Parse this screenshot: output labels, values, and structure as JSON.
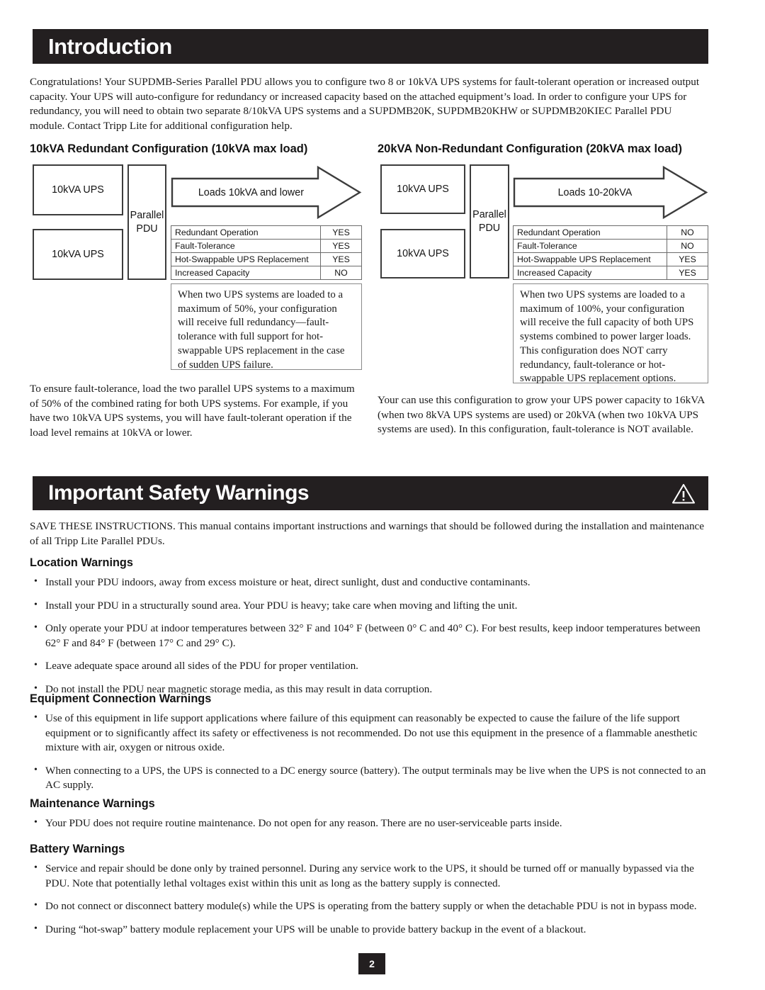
{
  "sections": {
    "introduction": {
      "title": "Introduction",
      "paragraph": "Congratulations! Your SUPDMB-Series Parallel PDU allows you to configure two 8 or 10kVA UPS systems for fault-tolerant operation or increased output capacity. Your UPS will auto-configure for redundancy or increased capacity based on the attached equipment’s load. In order to configure your UPS for redundancy, you will need to obtain two separate 8/10kVA UPS systems and a SUPDMB20K, SUPDMB20KHW or SUPDMB20KIEC Parallel PDU module. Contact Tripp Lite for additional configuration help."
    },
    "safety": {
      "title": "Important Safety Warnings",
      "icon": "warning-triangle-icon",
      "paragraph": "SAVE THESE INSTRUCTIONS. This manual contains important instructions and warnings that should be followed during the installation and maintenance of all Tripp Lite Parallel PDUs."
    }
  },
  "configurations": [
    {
      "title": "10kVA Redundant Configuration (10kVA max load)",
      "ups_boxes": [
        "10kVA UPS",
        "10kVA UPS"
      ],
      "pdu_label_line1": "Parallel",
      "pdu_label_line2": "PDU",
      "arrow_label": "Loads 10kVA and lower",
      "spec_rows": [
        {
          "label": "Redundant Operation",
          "value": "YES"
        },
        {
          "label": "Fault-Tolerance",
          "value": "YES"
        },
        {
          "label": "Hot-Swappable UPS Replacement",
          "value": "YES"
        },
        {
          "label": "Increased Capacity",
          "value": "NO"
        }
      ],
      "note": "When two UPS systems are loaded to a maximum of 50%, your configuration will receive full redundancy—fault-tolerance with full support for hot-swappable UPS replacement in the case of sudden UPS failure.",
      "paragraph": "To ensure fault-tolerance, load the two parallel UPS systems to a maximum of 50% of the combined rating for both UPS systems. For example, if you have two 10kVA UPS systems, you will have fault-tolerant operation if the load level remains at 10kVA or lower."
    },
    {
      "title": "20kVA Non-Redundant Configuration (20kVA max load)",
      "ups_boxes": [
        "10kVA UPS",
        "10kVA UPS"
      ],
      "pdu_label_line1": "Parallel",
      "pdu_label_line2": "PDU",
      "arrow_label": "Loads 10-20kVA",
      "spec_rows": [
        {
          "label": "Redundant Operation",
          "value": "NO"
        },
        {
          "label": "Fault-Tolerance",
          "value": "NO"
        },
        {
          "label": "Hot-Swappable UPS Replacement",
          "value": "YES"
        },
        {
          "label": "Increased Capacity",
          "value": "YES"
        }
      ],
      "note": "When two UPS systems are loaded to a maximum of 100%, your configuration will receive the full capacity of both UPS systems combined to power larger loads. This configuration does NOT carry redundancy, fault-tolerance or hot-swappable UPS replacement options.",
      "paragraph": "Your can use this configuration to grow your UPS power capacity to 16kVA (when two 8kVA UPS systems are used) or 20kVA (when two 10kVA UPS systems are used). In this configuration, fault-tolerance is NOT available."
    }
  ],
  "warning_groups": [
    {
      "heading": "Location Warnings",
      "items": [
        "Install your PDU indoors, away from excess moisture or heat, direct sunlight, dust and conductive contaminants.",
        "Install your PDU in a structurally sound area. Your PDU is heavy; take care when moving and lifting the unit.",
        "Only operate your PDU at indoor temperatures between 32° F and 104° F (between 0° C and 40° C). For best results, keep indoor temperatures between 62° F and 84° F (between 17° C and 29° C).",
        "Leave adequate space around all sides of the PDU for proper ventilation.",
        "Do not install the PDU near magnetic storage media, as this may result in data corruption."
      ]
    },
    {
      "heading": "Equipment Connection Warnings",
      "items": [
        "Use of this equipment in life support applications where failure of this equipment can reasonably be expected to cause the failure of the life support equipment or to significantly affect its safety or effectiveness is not recommended. Do not use this equipment in the presence of a flammable anesthetic mixture with air, oxygen or nitrous oxide.",
        "When connecting to a UPS, the UPS is connected to a DC energy source (battery). The output terminals may be live when the UPS is not connected to an AC supply."
      ]
    },
    {
      "heading": "Maintenance Warnings",
      "items": [
        "Your PDU does not require routine maintenance. Do not open for any reason. There are no user-serviceable parts inside."
      ]
    },
    {
      "heading": "Battery Warnings",
      "items": [
        "Service and repair should be done only by trained personnel. During any service work to the UPS, it should be turned off or manually bypassed via the PDU. Note that potentially lethal voltages exist within this unit as long as the battery supply is connected.",
        "Do not connect or disconnect battery module(s) while the UPS is operating from the battery supply or when the detachable PDU is not in bypass mode.",
        "During “hot-swap” battery module replacement your UPS will be unable to provide battery backup in the event of a blackout."
      ]
    }
  ],
  "footer": {
    "page_number": "2"
  },
  "colors": {
    "bar_background": "#231f20",
    "bar_text": "#ffffff",
    "body_text": "#1a1a1a",
    "box_border": "#3c3c3c",
    "table_border": "#6b6b6b"
  }
}
